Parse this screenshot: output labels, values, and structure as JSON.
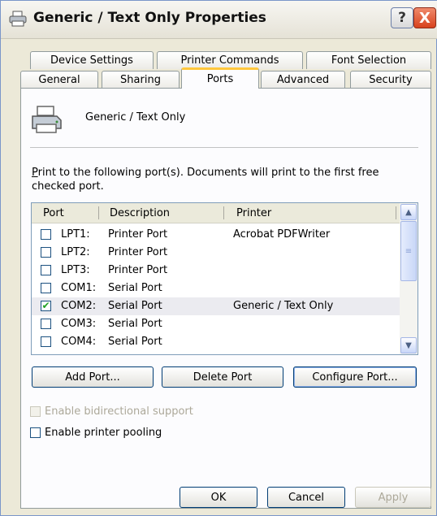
{
  "window": {
    "title": "Generic / Text Only Properties",
    "help": "?",
    "close": "X"
  },
  "tabs": {
    "row1": [
      "Device Settings",
      "Printer Commands",
      "Font Selection"
    ],
    "row2": [
      "General",
      "Sharing",
      "Ports",
      "Advanced",
      "Security"
    ],
    "active": "Ports"
  },
  "printer": {
    "name": "Generic / Text Only"
  },
  "description": {
    "first_letter": "P",
    "rest": "rint to the following port(s). Documents will print to the first free checked port."
  },
  "ports_list": {
    "headers": {
      "port": "Port",
      "description": "Description",
      "printer": "Printer"
    },
    "rows": [
      {
        "port": "LPT1:",
        "description": "Printer Port",
        "printer": "Acrobat PDFWriter",
        "checked": false
      },
      {
        "port": "LPT2:",
        "description": "Printer Port",
        "printer": "",
        "checked": false
      },
      {
        "port": "LPT3:",
        "description": "Printer Port",
        "printer": "",
        "checked": false
      },
      {
        "port": "COM1:",
        "description": "Serial Port",
        "printer": "",
        "checked": false
      },
      {
        "port": "COM2:",
        "description": "Serial Port",
        "printer": "Generic / Text Only",
        "checked": true
      },
      {
        "port": "COM3:",
        "description": "Serial Port",
        "printer": "",
        "checked": false
      },
      {
        "port": "COM4:",
        "description": "Serial Port",
        "printer": "",
        "checked": false
      }
    ],
    "check_glyph": "✔"
  },
  "buttons": {
    "add_port": "Add Port...",
    "delete_port": "Delete Port",
    "configure_port": "Configure Port...",
    "ok": "OK",
    "cancel": "Cancel",
    "apply": "Apply"
  },
  "options": {
    "bidirectional": "Enable bidirectional support",
    "pooling": "Enable printer pooling"
  },
  "colors": {
    "title_text": "#111111",
    "tab_highlight": "#ffc73c",
    "button_border": "#003c74",
    "disabled_text": "#aca899"
  },
  "icons": {
    "title": "printer-icon",
    "printer": "printer-icon",
    "scroll_up": "scroll-up-arrow-icon",
    "scroll_down": "scroll-down-arrow-icon"
  }
}
